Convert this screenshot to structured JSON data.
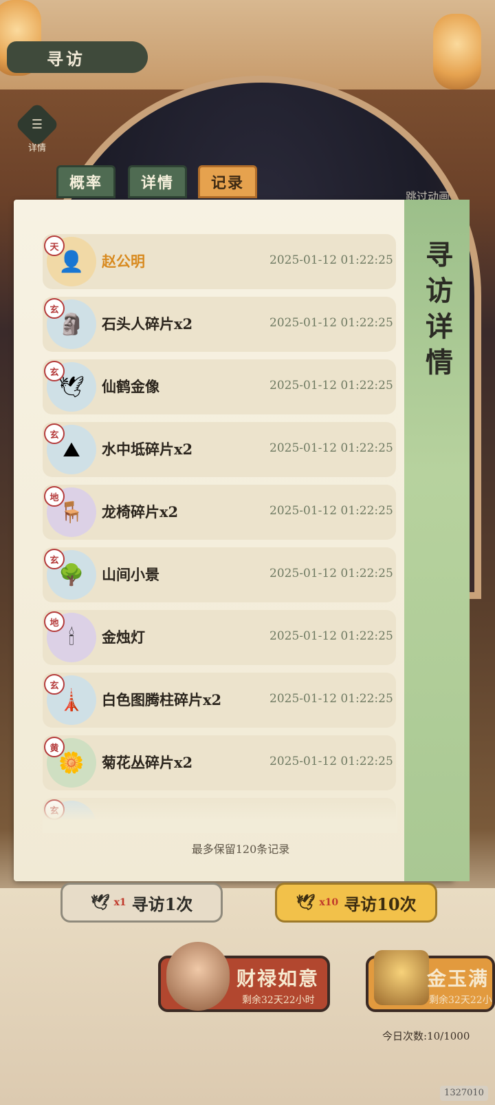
{
  "header": {
    "title": "寻访",
    "detail_label": "详情",
    "detail_icon": "menu-icon"
  },
  "tabs": [
    {
      "label": "概率",
      "active": false
    },
    {
      "label": "详情",
      "active": false
    },
    {
      "label": "记录",
      "active": true
    }
  ],
  "skip_label": "跳过动画",
  "side_title": "寻访详情",
  "records": [
    {
      "grade": "天",
      "name": "赵公明",
      "time": "2025-01-12  01:22:25",
      "special": true,
      "bg": "gold",
      "icon": "👤"
    },
    {
      "grade": "玄",
      "name": "石头人碎片x2",
      "time": "2025-01-12  01:22:25",
      "bg": "blue",
      "icon": "🗿"
    },
    {
      "grade": "玄",
      "name": "仙鹤金像",
      "time": "2025-01-12  01:22:25",
      "bg": "blue",
      "icon": "🕊"
    },
    {
      "grade": "玄",
      "name": "水中坻碎片x2",
      "time": "2025-01-12  01:22:25",
      "bg": "blue",
      "icon": "⛰"
    },
    {
      "grade": "地",
      "name": "龙椅碎片x2",
      "time": "2025-01-12  01:22:25",
      "bg": "purple",
      "icon": "🪑"
    },
    {
      "grade": "玄",
      "name": "山间小景",
      "time": "2025-01-12  01:22:25",
      "bg": "blue",
      "icon": "🌳"
    },
    {
      "grade": "地",
      "name": "金烛灯",
      "time": "2025-01-12  01:22:25",
      "bg": "purple",
      "icon": "🕯"
    },
    {
      "grade": "玄",
      "name": "白色图腾柱碎片x2",
      "time": "2025-01-12  01:22:25",
      "bg": "blue",
      "icon": "🗼"
    },
    {
      "grade": "黄",
      "name": "菊花丛碎片x2",
      "time": "2025-01-12  01:22:25",
      "bg": "green",
      "icon": "🌼"
    },
    {
      "grade": "玄",
      "name": "",
      "time": "",
      "bg": "blue",
      "icon": ""
    }
  ],
  "footnote": "最多保留120条记录",
  "draw_buttons": [
    {
      "count": "x1",
      "label": "寻访1次"
    },
    {
      "count": "x10",
      "label": "寻访10次"
    }
  ],
  "events": [
    {
      "title": "财禄如意",
      "sub": "剩余32天22小时"
    },
    {
      "title": "金玉满",
      "sub": "剩余32天22小"
    }
  ],
  "daily_count": "今日次数:10/1000",
  "build_code": "1327010",
  "colors": {
    "accent": "#e6a24e",
    "tab": "#4f6b52",
    "special_name": "#d88a1f",
    "time": "#6f7a62"
  }
}
